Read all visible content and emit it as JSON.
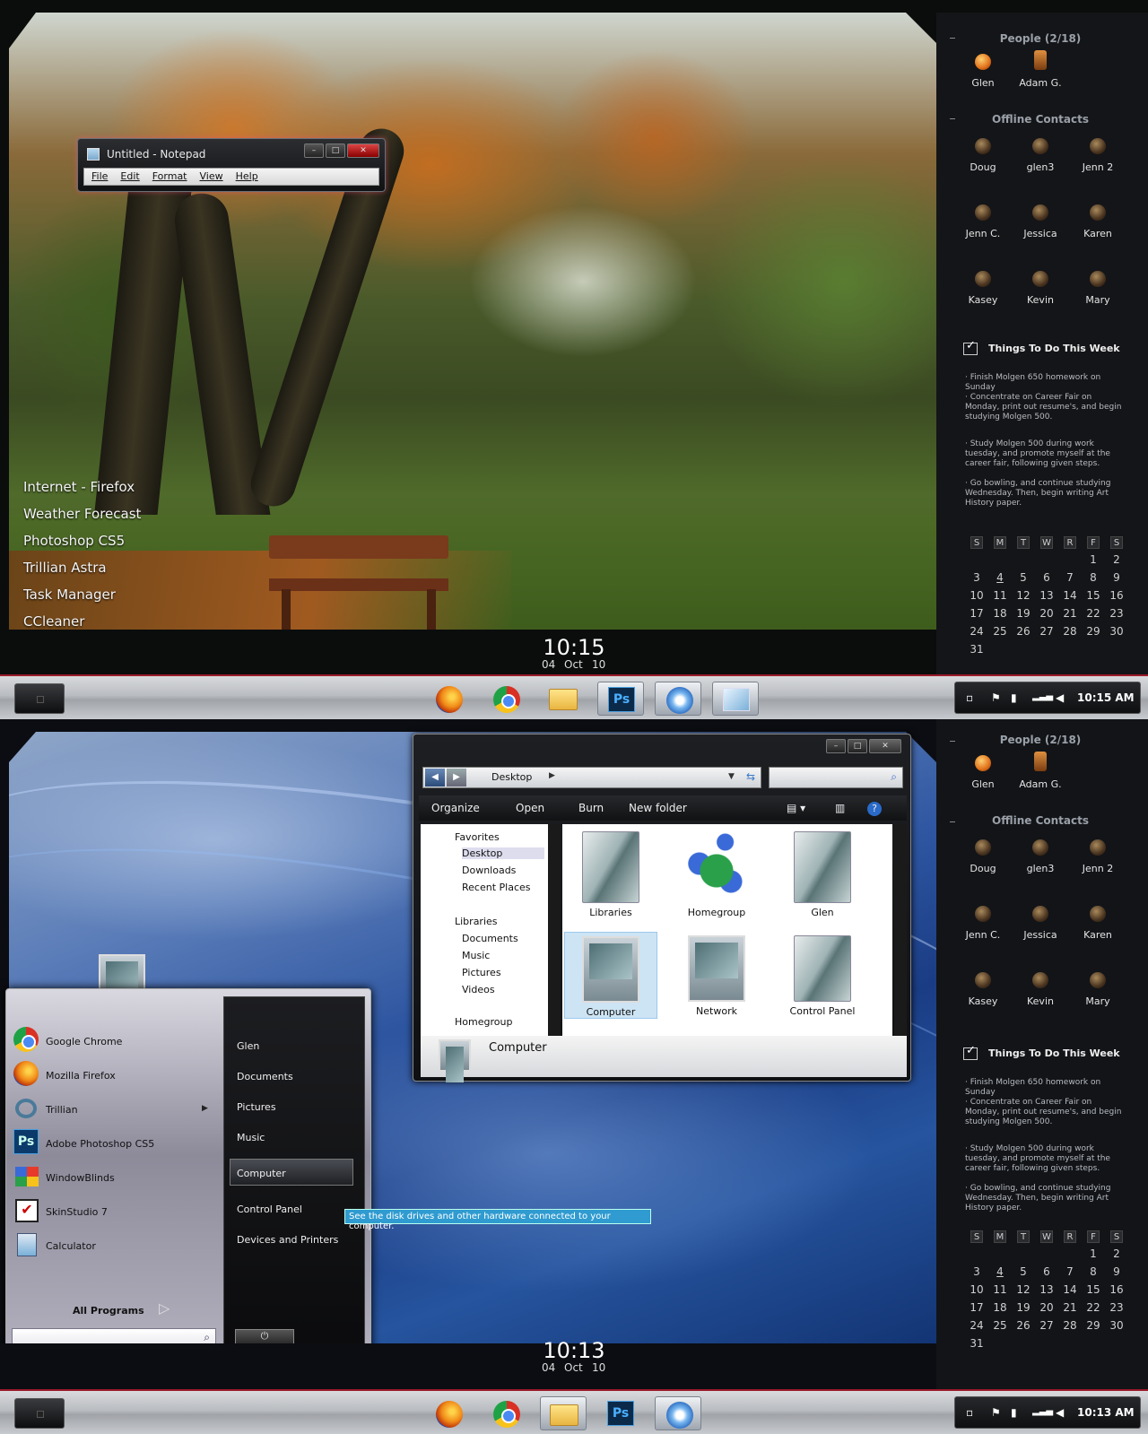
{
  "top": {
    "notepad": {
      "title": "Untitled - Notepad",
      "menu": [
        "File",
        "Edit",
        "Format",
        "View",
        "Help"
      ]
    },
    "desktop_links": [
      "Internet - Firefox",
      "Weather Forecast",
      "Photoshop CS5",
      "Trillian Astra",
      "Task Manager",
      "CCleaner"
    ],
    "clock": {
      "time": "10:15",
      "day": "04",
      "month": "Oct",
      "year": "10"
    },
    "tray_time": "10:15 AM"
  },
  "bottom": {
    "clock": {
      "time": "10:13",
      "day": "04",
      "month": "Oct",
      "year": "10"
    },
    "tray_time": "10:13 AM",
    "explorer": {
      "address": "Desktop",
      "toolbar": [
        "Organize",
        "Open",
        "Burn",
        "New folder"
      ],
      "nav": {
        "favorites": "Favorites",
        "fav_items": [
          "Desktop",
          "Downloads",
          "Recent Places"
        ],
        "libraries": "Libraries",
        "lib_items": [
          "Documents",
          "Music",
          "Pictures",
          "Videos"
        ],
        "homegroup": "Homegroup"
      },
      "items": [
        "Libraries",
        "Homegroup",
        "Glen",
        "Computer",
        "Network",
        "Control Panel"
      ],
      "details": "Computer"
    },
    "start_menu": {
      "programs": [
        "Google Chrome",
        "Mozilla Firefox",
        "Trillian",
        "Adobe Photoshop CS5",
        "WindowBlinds",
        "SkinStudio 7",
        "Calculator"
      ],
      "all_programs": "All Programs",
      "places": [
        "Glen",
        "Documents",
        "Pictures",
        "Music",
        "Computer",
        "Control Panel",
        "Devices and Printers"
      ],
      "tooltip": "See the disk drives and other hardware connected to your computer."
    }
  },
  "side": {
    "people_header": "People (2/18)",
    "online": [
      "Glen",
      "Adam G."
    ],
    "offline_header": "Offline Contacts",
    "offline": [
      "Doug",
      "glen3",
      "Jenn 2",
      "Jenn C.",
      "Jessica",
      "Karen",
      "Kasey",
      "Kevin",
      "Mary"
    ],
    "todo_header": "Things To Do This Week",
    "todo": [
      "· Finish Molgen 650 homework on Sunday",
      "· Concentrate on Career Fair on Monday, print out resume's, and begin studying Molgen 500.",
      "· Study Molgen 500 during work tuesday, and promote myself at the career fair, following given steps.",
      "· Go bowling, and continue studying Wednesday. Then, begin writing Art History paper."
    ],
    "cal_days": [
      "S",
      "M",
      "T",
      "W",
      "R",
      "F",
      "S"
    ],
    "cal_weeks": [
      [
        "",
        "",
        "",
        "",
        "",
        "1",
        "2"
      ],
      [
        "3",
        "4",
        "5",
        "6",
        "7",
        "8",
        "9"
      ],
      [
        "10",
        "11",
        "12",
        "13",
        "14",
        "15",
        "16"
      ],
      [
        "17",
        "18",
        "19",
        "20",
        "21",
        "22",
        "23"
      ],
      [
        "24",
        "25",
        "26",
        "27",
        "28",
        "29",
        "30"
      ],
      [
        "31",
        "",
        "",
        "",
        "",
        "",
        ""
      ]
    ]
  }
}
